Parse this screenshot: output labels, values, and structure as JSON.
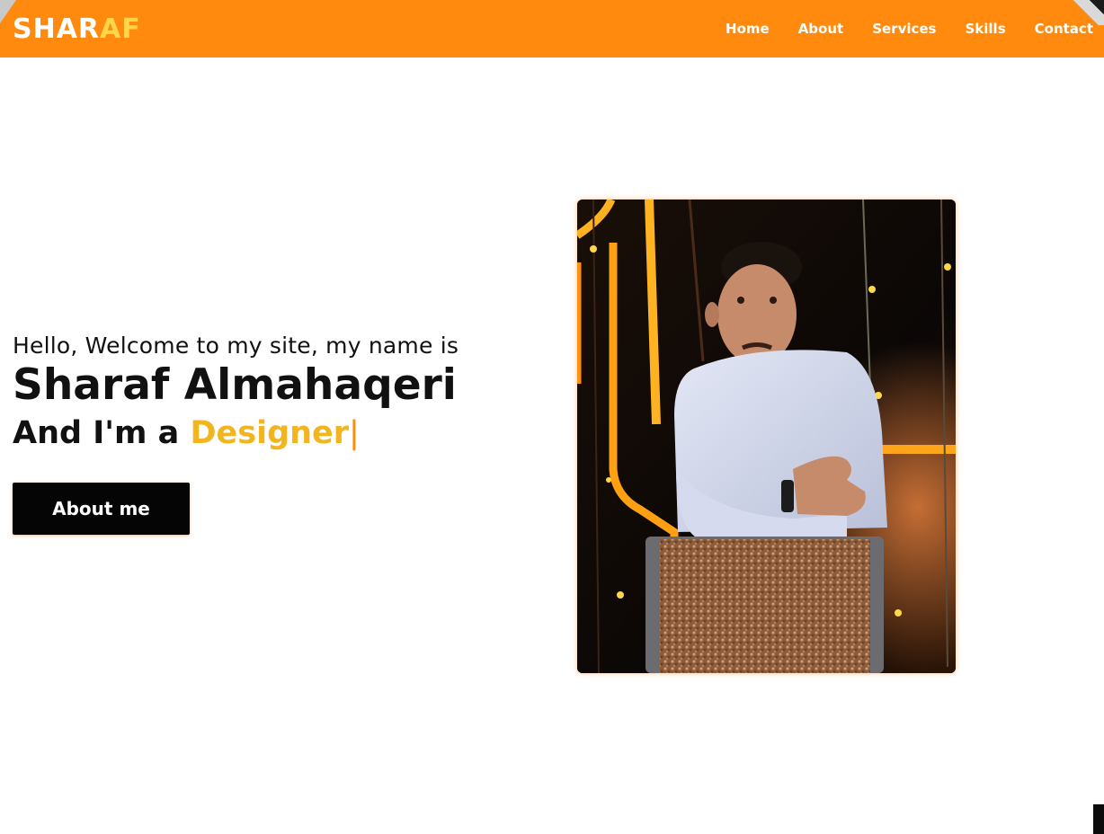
{
  "header": {
    "logo_main": "SHAR",
    "logo_accent": "AF",
    "nav": [
      {
        "label": "Home"
      },
      {
        "label": "About"
      },
      {
        "label": "Services"
      },
      {
        "label": "Skills"
      },
      {
        "label": "Contact"
      }
    ]
  },
  "hero": {
    "greeting": "Hello, Welcome to my site, my name is",
    "name": "Sharaf Almahaqeri",
    "role_prefix": "And I'm a ",
    "role": "Designer",
    "cursor": "|",
    "cta_label": "About me"
  },
  "colors": {
    "accent": "#ff8a0d",
    "role_highlight": "#f3b51f",
    "button_bg": "#050505"
  },
  "icons": {
    "photo": "portrait-photo"
  }
}
